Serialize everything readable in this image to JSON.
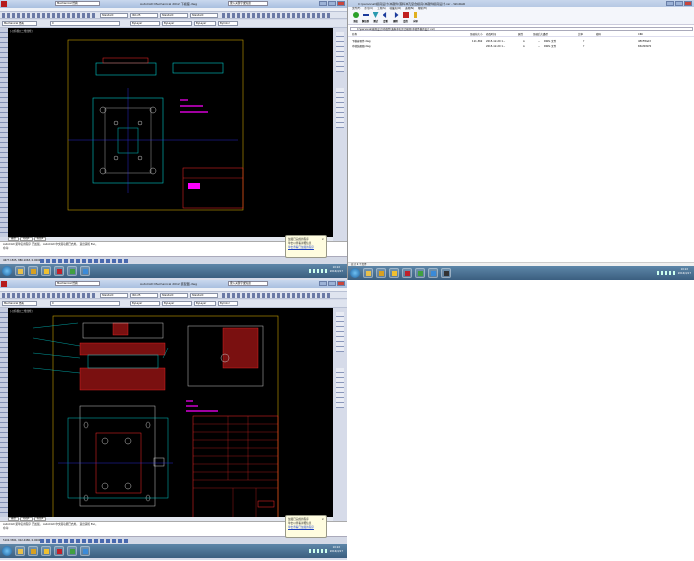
{
  "cad_windows": [
    {
      "title": "AutoCAD Mechanical 2012  下模座.dwg",
      "workspace": "Mechanical 经典",
      "search_placeholder": "键入关键字或短语",
      "viewport_label": "[-][俯视][二维线框]",
      "toolbar": {
        "text_style": "Standard",
        "dim_style": "ISO-25",
        "table_style": "Standard",
        "multileader_style": "Standard",
        "layer": "0",
        "color": "ByLayer",
        "linetype": "ByLayer",
        "lineweight": "ByLayer",
        "plot_style": "ByColor",
        "workspace_combo": "Mechanical 经典"
      },
      "tabs": [
        "模型",
        "布局1",
        "布局2"
      ],
      "command_lines": [
        "AutoCAD 菜单实用程序 已加载。 AutoCAD 中文版功能已启用。 退出请按 Esc。",
        "命令:"
      ],
      "coordinates": "4677.1505, 880.1063, 0.0000",
      "balloon": {
        "title": "加载已完成的程序",
        "text": "单击以查看详细信息",
        "link": "单击查看已加载的程序"
      },
      "clock": {
        "time": "10:22",
        "date": "2016/4/17"
      }
    },
    {
      "title": "AutoCAD Mechanical 2012  装配图.dwg",
      "workspace": "Mechanical 经典",
      "search_placeholder": "键入关键字或短语",
      "viewport_label": "[-][俯视][二维线框]",
      "toolbar": {
        "text_style": "Standard",
        "dim_style": "ISO-25",
        "table_style": "Standard",
        "multileader_style": "Standard",
        "layer": "0",
        "color": "ByLayer",
        "linetype": "ByLayer",
        "lineweight": "ByLayer",
        "plot_style": "ByColor",
        "workspace_combo": "Mechanical 经典"
      },
      "tabs": [
        "模型",
        "布局1",
        "布局2"
      ],
      "command_lines": [
        "AutoCAD 菜单实用程序 已加载。 AutoCAD 中文版功能已启用。 退出请按 Esc。",
        "命令:"
      ],
      "coordinates": "5102.3361, 912.4480, 0.0000",
      "balloon": {
        "title": "加载已完成的程序",
        "text": "单击以查看详细信息",
        "link": "单击查看已加载的程序"
      },
      "clock": {
        "time": "10:22",
        "date": "2016/4/17"
      }
    }
  ],
  "archive_window": {
    "title": "C:\\personal\\模具设计\\冲裁件\\落料冲孔复合模具\\冲裁件模具设计.rar - WinRAR",
    "menu": [
      "文件(F)",
      "命令(C)",
      "工具(S)",
      "收藏夹(O)",
      "选项(N)",
      "帮助(H)"
    ],
    "tools": [
      "添加",
      "解压到",
      "测试",
      "查看",
      "删除",
      "查找",
      "向导"
    ],
    "address": "C:\\personal\\模具设计\\冲裁件\\落料冲孔复合模具\\冲裁件模具设计.rar\\",
    "columns": [
      "名称",
      "压缩前大小",
      "修改时间",
      "属性",
      "压缩后大小",
      "类型",
      "比率",
      "密码",
      "CRC"
    ],
    "files": [
      {
        "name": "下模座零件.dwg",
        "size": "111,362",
        "modified": "2015-12-20 1...",
        "attr": "A",
        "packed": "--",
        "type": "DWG 文件",
        "ratio": "?",
        "crc": "4ECF84A3"
      },
      {
        "name": "冲裁装配图.dwg",
        "size": "",
        "modified": "2015-12-20 1...",
        "attr": "A",
        "packed": "--",
        "type": "DWG 文件",
        "ratio": "?",
        "crc": "65A3D970"
      }
    ],
    "status": "总计 2 个文件",
    "clock": {
      "time": "10:22",
      "date": "2016/4/17"
    }
  },
  "colors": {
    "canvas": "#000000",
    "border_line": "#c8a000",
    "cyan": "#00c8c8",
    "magenta": "#ff00ff",
    "red": "#ff2a2a",
    "dark_red": "#7a1010",
    "taskbar": "#4a7194"
  }
}
